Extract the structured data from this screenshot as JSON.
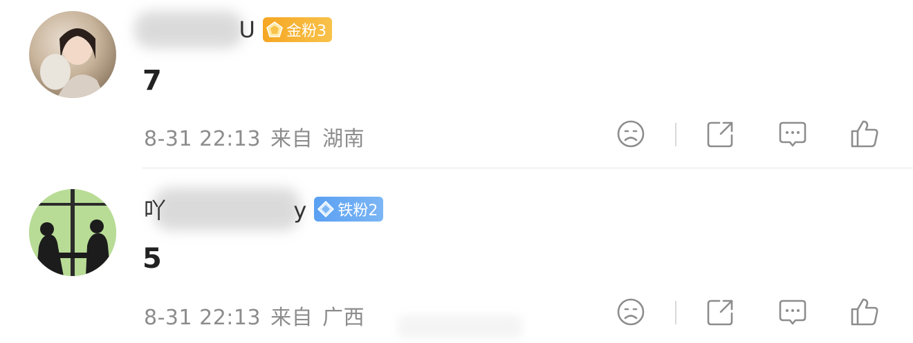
{
  "comments": [
    {
      "username_visible": "U",
      "badge": {
        "label": "金粉3",
        "type": "gold",
        "icon": "pentagon-gem-icon",
        "color": "#f6a623"
      },
      "content": "7",
      "meta": {
        "time": "8-31 22:13",
        "from": "来自",
        "location": "湖南"
      },
      "actions": [
        "dislike-face-icon",
        "share-icon",
        "comment-icon",
        "like-icon"
      ]
    },
    {
      "username_visible_start": "吖",
      "username_visible_end": "y",
      "badge": {
        "label": "铁粉2",
        "type": "iron",
        "icon": "diamond-gem-icon",
        "color": "#5aa0f2"
      },
      "content": "5",
      "meta": {
        "time": "8-31 22:13",
        "from": "来自",
        "location": "广西"
      },
      "actions": [
        "dislike-face-icon",
        "share-icon",
        "comment-icon",
        "like-icon"
      ]
    }
  ]
}
